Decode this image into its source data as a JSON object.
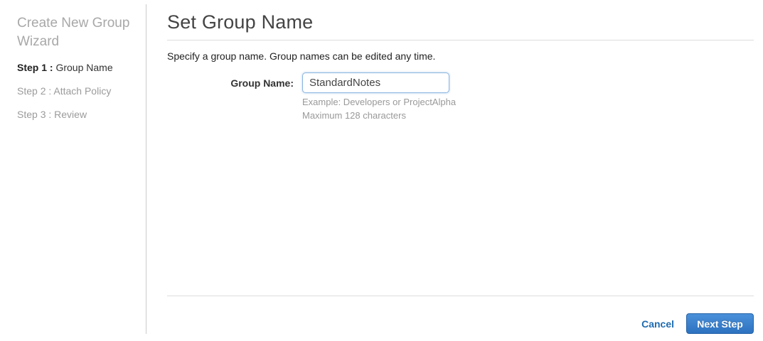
{
  "sidebar": {
    "title": "Create New Group Wizard",
    "steps": [
      {
        "prefix": "Step 1 :",
        "label": "Group Name",
        "active": true
      },
      {
        "prefix": "Step 2 :",
        "label": "Attach Policy",
        "active": false
      },
      {
        "prefix": "Step 3 :",
        "label": "Review",
        "active": false
      }
    ]
  },
  "main": {
    "title": "Set Group Name",
    "description": "Specify a group name. Group names can be edited any time.",
    "form": {
      "group_name_label": "Group Name:",
      "group_name_value": "StandardNotes",
      "hint_example": "Example: Developers or ProjectAlpha",
      "hint_max": "Maximum 128 characters"
    },
    "footer": {
      "cancel_label": "Cancel",
      "next_label": "Next Step"
    }
  },
  "colors": {
    "link_blue": "#1f6bb0",
    "button_blue_top": "#4a90d9",
    "button_blue_bottom": "#2d72c0",
    "input_border": "#8ab5e0",
    "divider": "#dddddd",
    "muted_text": "#999999"
  }
}
